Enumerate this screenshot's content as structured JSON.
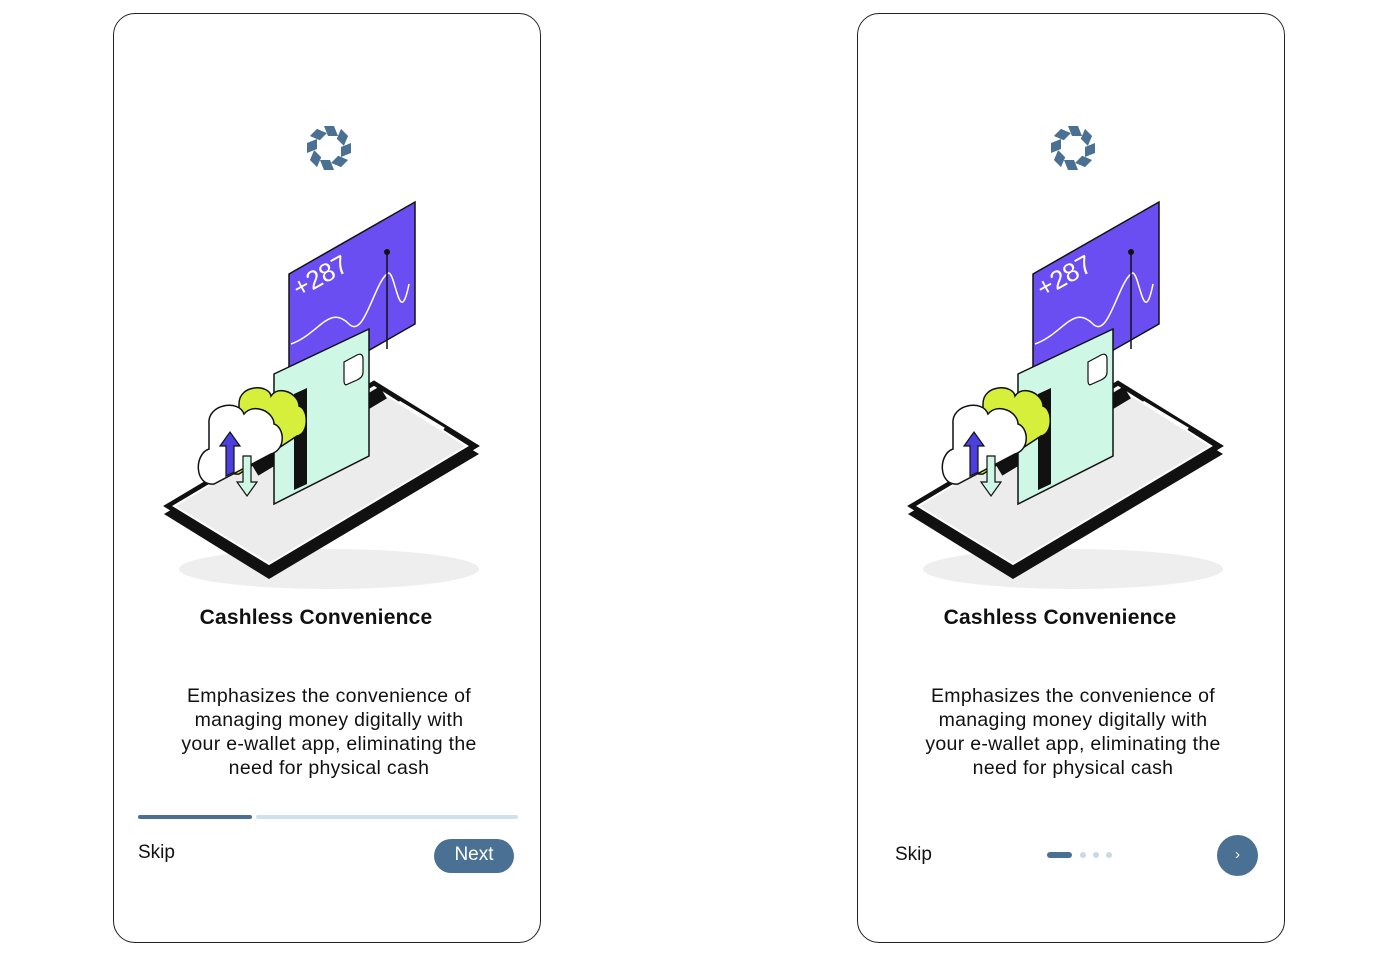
{
  "onboarding_a": {
    "title": "Cashless Convenience",
    "description": "Emphasizes the convenience of\nmanaging money digitally with\nyour e-wallet app, eliminating the\nneed for physical cash",
    "skip_label": "Skip",
    "next_label": "Next",
    "progress_fraction": 0.3
  },
  "onboarding_b": {
    "title": "Cashless Convenience",
    "description": "Emphasizes the convenience of\nmanaging money digitally with\nyour e-wallet app, eliminating the\nneed for physical cash",
    "skip_label": "Skip",
    "page_indicator": {
      "current": 1,
      "total": 4
    },
    "next_icon": "chevron-right-icon"
  },
  "illustration": {
    "card_value": "+287",
    "icons": [
      "app-logo-icon",
      "cloud-upload-download-icon",
      "credit-card-icon",
      "smartphone-icon",
      "chart-card-icon"
    ]
  },
  "colors": {
    "accent": "#4a7193",
    "accent_light": "#cfe0ee",
    "chart_card": "#6a4ef2",
    "credit_card": "#cef7e6",
    "cloud_lime": "#d6ef3a",
    "phone": "#111111",
    "arrow_blue": "#4b3fdd"
  }
}
